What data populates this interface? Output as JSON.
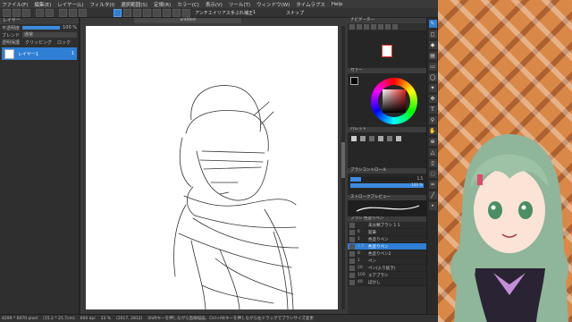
{
  "menu": [
    "ファイル(F)",
    "編集(E)",
    "レイヤー(L)",
    "フィルタ(I)",
    "選択範囲(S)",
    "定規(R)",
    "カラー(C)",
    "表示(V)",
    "ツール(T)",
    "ウィンドウ(W)",
    "タイムラプス",
    "Help"
  ],
  "toolbar": {
    "antialias_label": "アンチエイリアス",
    "correction_label": "手ぶれ補正",
    "correction_value": "1",
    "snap_label": "スナップ"
  },
  "layer_panel": {
    "title": "レイヤー",
    "opacity_label": "不透明度",
    "opacity_value": "100 %",
    "opacity_level": 1.0,
    "blend_label": "ブレンド",
    "blend_value": "通常",
    "clipping_label": "クリッピング",
    "protect_alpha_label": "透明保護",
    "lock_label": "ロック",
    "layers": [
      {
        "name": "レイヤー1",
        "tag": "1"
      }
    ]
  },
  "document": {
    "tab": "untitled"
  },
  "navigator": {
    "title": "ナビゲーター"
  },
  "color": {
    "title": "カラー",
    "foreground": "#000000",
    "background": "#ffffff"
  },
  "palette": {
    "title": "パレット"
  },
  "brush_control": {
    "title": "ブラシコントロール",
    "size_value": "1.5",
    "size_level": 0.15,
    "opacity_value": "100 %",
    "opacity_level": 1.0
  },
  "stroke_preview": {
    "title": "ストロークプレビュー"
  },
  "brush_list": {
    "title": "ブラシ 色塗りペン",
    "items": [
      {
        "size": "",
        "name": "未分類ブラシ 1 1"
      },
      {
        "size": "6",
        "name": "鉛筆"
      },
      {
        "size": "1",
        "name": "色塗りペン"
      },
      {
        "size": "1.5",
        "name": "色塗りペン",
        "active": true
      },
      {
        "size": "8",
        "name": "色塗りペン2"
      },
      {
        "size": "1",
        "name": "ペン"
      },
      {
        "size": "20",
        "name": "ペン(入り抜き)"
      },
      {
        "size": "100",
        "name": "エアブラシ"
      },
      {
        "size": "40",
        "name": "ぼかし"
      }
    ]
  },
  "status": {
    "size": "4299 * 6070 pixel",
    "cm": "(15.2 * 25.7cm)",
    "dpi": "600 dpi",
    "zoom": "33 %",
    "coords": "(2017, 2812)",
    "hint": "Shiftキーを押しながら直線描画、Ctrl+Altキーを押しながら左ドラッグでブラシサイズ変更"
  },
  "tools": [
    "pen",
    "eraser",
    "fill",
    "gradient",
    "select",
    "lasso",
    "wand",
    "move",
    "text",
    "eyedropper",
    "hand",
    "zoom",
    "shape",
    "ruler",
    "blur",
    "smudge",
    "line",
    "dot"
  ]
}
